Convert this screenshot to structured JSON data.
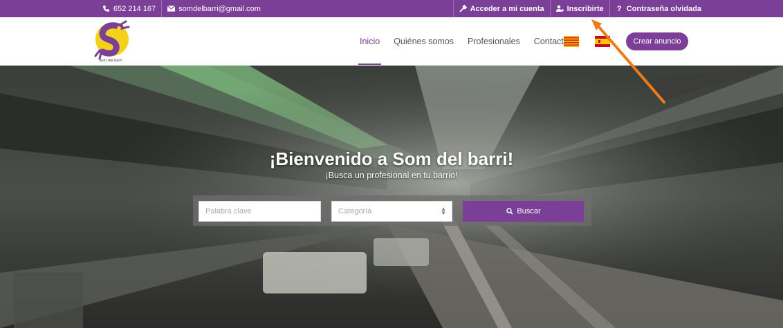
{
  "topbar": {
    "phone": "652 214 167",
    "email": "somdelbarri@gmail.com",
    "login": "Acceder a mi cuenta",
    "register": "Inscribirte",
    "forgot": "Contraseña olvidada"
  },
  "header": {
    "logo_text": "Som del barri",
    "nav": [
      "Inicio",
      "Quiénes somos",
      "Profesionales",
      "Contacto"
    ],
    "active_nav": "Inicio",
    "create_button": "Crear anuncio"
  },
  "hero": {
    "title": "¡Bienvenido a Som del barri!",
    "subtitle": "¡Busca un profesional en tu barrio!"
  },
  "search": {
    "keyword_placeholder": "Palabra clave",
    "category_value": "Categoría",
    "button": "Buscar"
  },
  "colors": {
    "brand_purple": "#7b3f97",
    "logo_yellow": "#f4d21c",
    "annotation_arrow": "#f07a1a"
  }
}
